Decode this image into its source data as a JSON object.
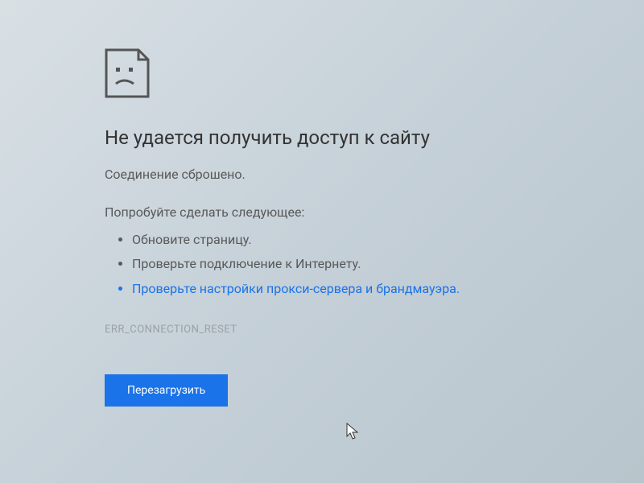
{
  "error": {
    "title": "Не удается получить доступ к сайту",
    "subtitle": "Соединение сброшено.",
    "suggestions_header": "Попробуйте сделать следующее:",
    "suggestions": [
      "Обновите страницу.",
      "Проверьте подключение к Интернету.",
      "Проверьте настройки прокси-сервера и брандмауэра."
    ],
    "code": "ERR_CONNECTION_RESET",
    "reload_button": "Перезагрузить"
  }
}
